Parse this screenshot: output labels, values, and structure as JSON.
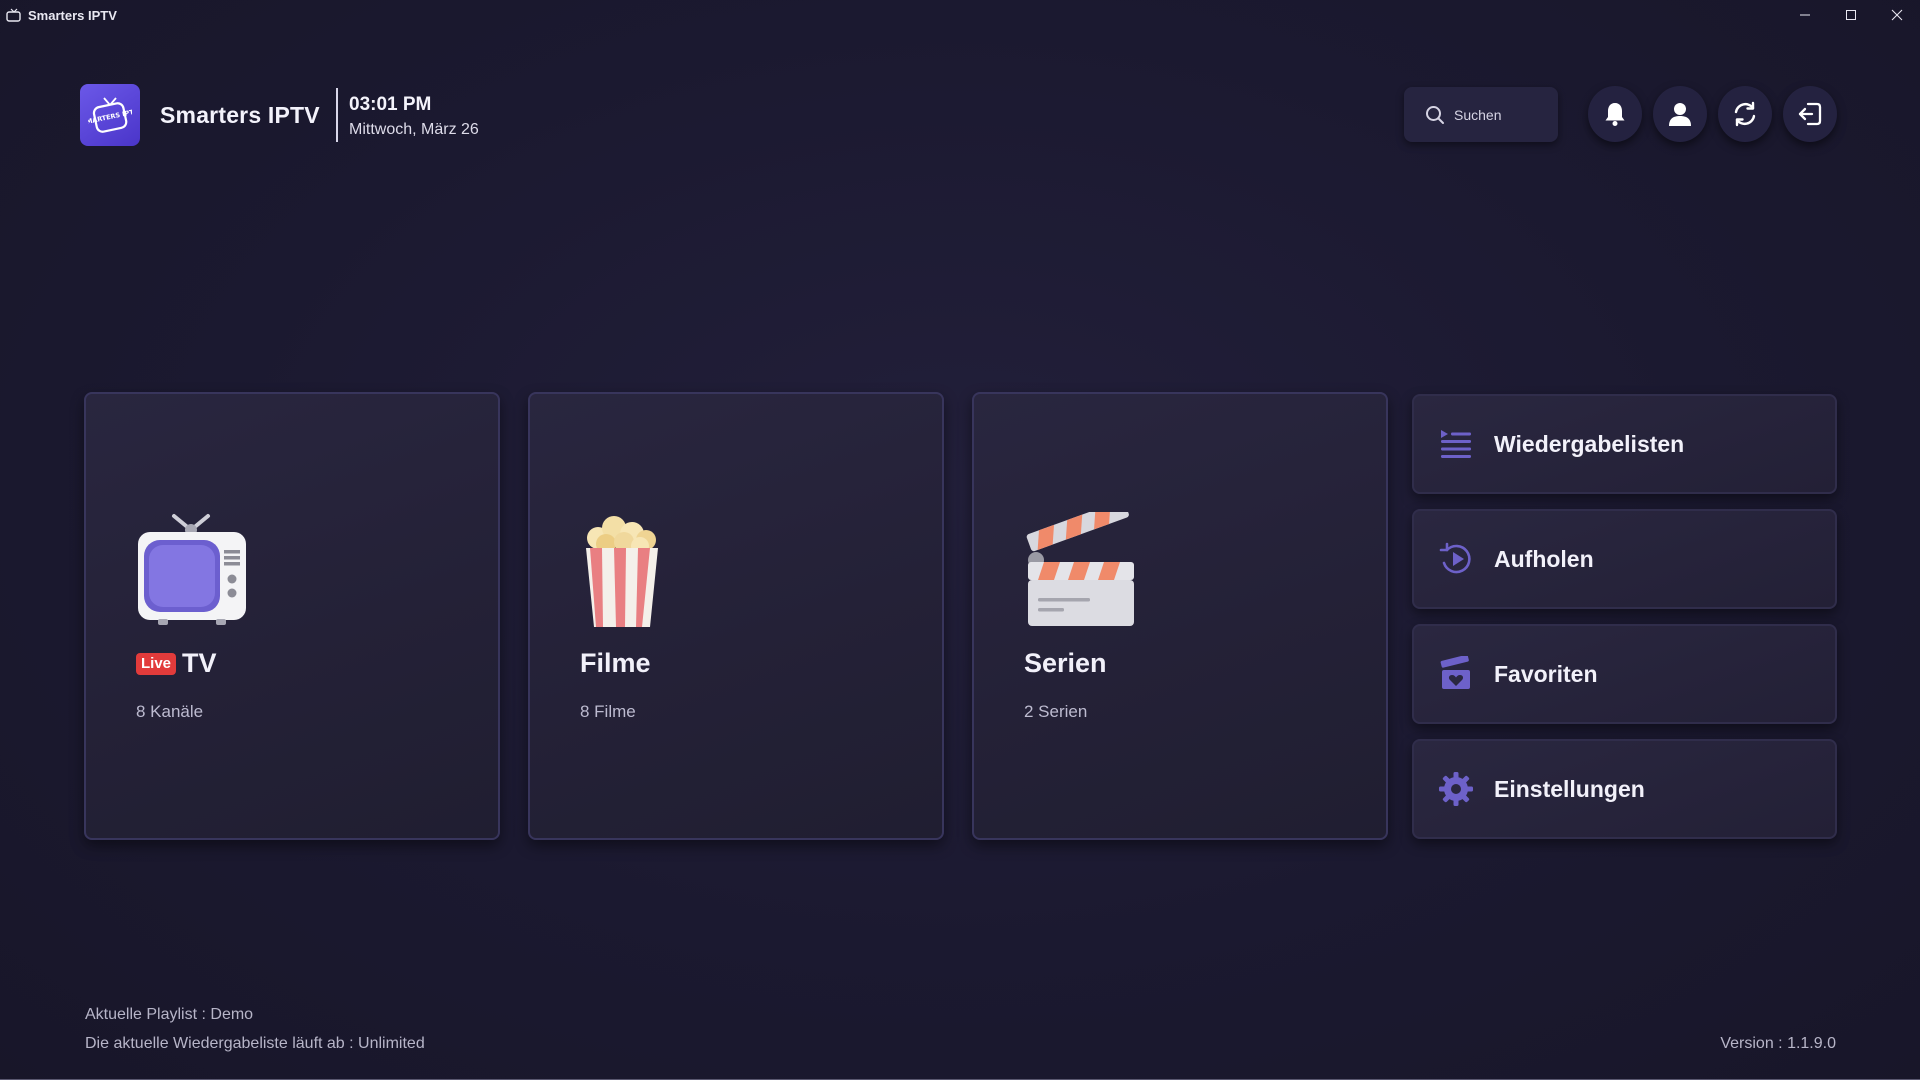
{
  "window": {
    "title": "Smarters IPTV"
  },
  "header": {
    "logo_text": "SMARTERS IPTV",
    "brand": "Smarters IPTV",
    "time": "03:01 PM",
    "date": "Mittwoch, März 26",
    "search_placeholder": "Suchen",
    "icons": [
      "bell-icon",
      "user-icon",
      "refresh-icon",
      "logout-icon"
    ]
  },
  "cards": [
    {
      "badge": "Live",
      "title": "TV",
      "count": "8 Kanäle",
      "icon": "tv-icon"
    },
    {
      "title": "Filme",
      "count": "8 Filme",
      "icon": "popcorn-icon"
    },
    {
      "title": "Serien",
      "count": "2 Serien",
      "icon": "clapperboard-icon"
    }
  ],
  "side_menu": [
    {
      "label": "Wiedergabelisten",
      "icon": "playlist-icon"
    },
    {
      "label": "Aufholen",
      "icon": "catchup-icon"
    },
    {
      "label": "Favoriten",
      "icon": "favorites-icon"
    },
    {
      "label": "Einstellungen",
      "icon": "settings-gear-icon"
    }
  ],
  "footer": {
    "playlist": "Aktuelle Playlist : Demo",
    "expiry": "Die aktuelle Wiedergabeliste läuft ab : Unlimited",
    "version": "Version : 1.1.9.0"
  },
  "colors": {
    "background": "#1b1930",
    "accent": "#6b58e8",
    "live_badge": "#e23b3b",
    "icon_tint": "#6d61c9"
  }
}
